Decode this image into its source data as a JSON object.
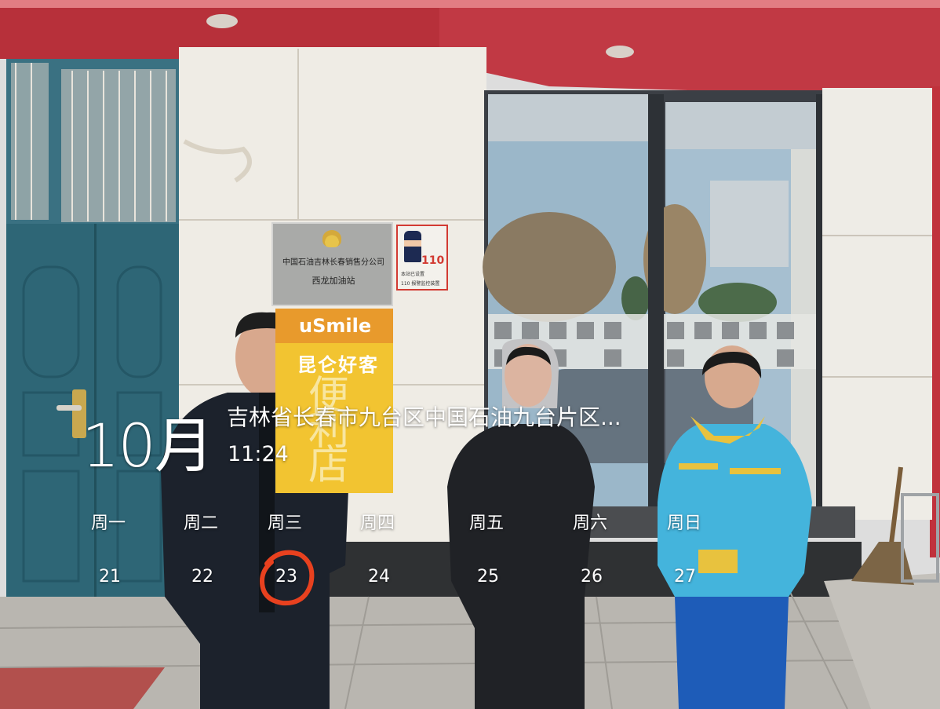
{
  "watermark": {
    "month": "10月",
    "location": "吉林省长春市九台区中国石油九台片区...",
    "time": "11:24",
    "weekdays": [
      "周一",
      "周二",
      "周三",
      "周四",
      "周五",
      "周六",
      "周日"
    ],
    "days": [
      "21",
      "22",
      "23",
      "24",
      "25",
      "26",
      "27"
    ],
    "highlighted_day": "23",
    "highlight_color": "#e8411f"
  },
  "station_sign": {
    "company": "中国石油吉林长春销售分公司",
    "station": "西龙加油站"
  },
  "police_sign": {
    "number": "110",
    "line1": "本站已设置",
    "line2": "110 报警监控装置"
  },
  "shop_sign": {
    "brand": "uSmile",
    "slogan": "昆仑好客",
    "big_chars": "便利店"
  }
}
